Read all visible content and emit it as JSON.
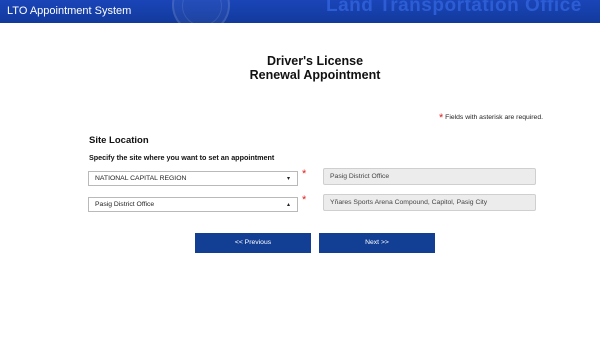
{
  "header": {
    "app_title": "LTO Appointment System",
    "agency_watermark": "Land Transportation Office"
  },
  "page": {
    "title_line1": "Driver's License",
    "title_line2": "Renewal Appointment"
  },
  "required_note": {
    "asterisk": "*",
    "text": "Fields with asterisk are required."
  },
  "site_location": {
    "heading": "Site Location",
    "instruction": "Specify the site where you want to set an appointment",
    "region_select": {
      "value": "NATIONAL CAPITAL REGION",
      "caret": "▾"
    },
    "office_select": {
      "value": "Pasig District Office",
      "caret": "▴"
    },
    "office_name_display": "Pasig District Office",
    "office_address_display": "Yñares Sports Arena Compound, Capitol, Pasig City",
    "required_marker": "*"
  },
  "buttons": {
    "previous": "<< Previous",
    "next": "Next >>"
  },
  "colors": {
    "header_bg": "#123a9c",
    "button_bg": "#123f94",
    "required_red": "#e02020"
  }
}
